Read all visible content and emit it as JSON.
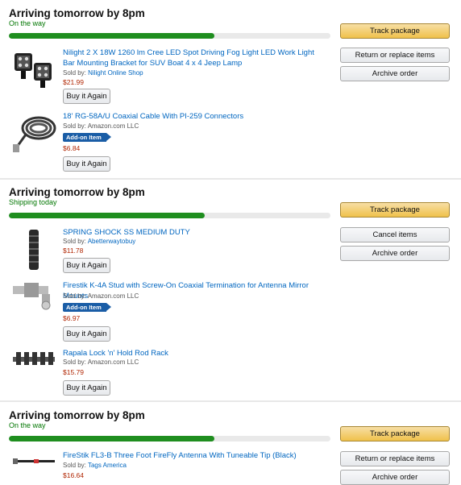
{
  "shipments": [
    {
      "title": "Arriving tomorrow by 8pm",
      "status": "On the way",
      "progress": 0.64,
      "buttons": [
        "Track package",
        "Return or replace items",
        "Archive order"
      ],
      "items": [
        {
          "title": "Nilight 2 X 18W 1260 lm Cree LED Spot Driving Fog Light LED Work Light Bar Mounting Bracket for SUV Boat 4 x 4 Jeep Lamp",
          "sold_by_label": "Sold by:",
          "seller": "Nilight Online Shop",
          "price": "$21.99",
          "buy_again": "Buy it Again",
          "thumb_icon": "led-light-pair-icon"
        },
        {
          "title": "18' RG-58A/U Coaxial Cable With PI-259 Connectors",
          "sold_by_label": "Sold by:",
          "seller": "Amazon.com LLC",
          "addon": "Add-on Item",
          "price": "$6.84",
          "buy_again": "Buy it Again",
          "thumb_icon": "coaxial-cable-icon"
        }
      ]
    },
    {
      "title": "Arriving tomorrow by 8pm",
      "status": "Shipping today",
      "progress": 0.61,
      "buttons": [
        "Track package",
        "Cancel items",
        "Archive order"
      ],
      "items": [
        {
          "title": "SPRING SHOCK SS MEDIUM DUTY",
          "sold_by_label": "Sold by:",
          "seller": "Abetterwaytobuy",
          "price": "$11.78",
          "buy_again": "Buy it Again",
          "thumb_icon": "spring-shock-icon"
        },
        {
          "title": "Firestik K-4A Stud with Screw-On Coaxial Termination for Antenna Mirror Mounts",
          "sold_by_label": "Sold by:",
          "seller": "Amazon.com LLC",
          "addon": "Add-on Item",
          "price": "$6.97",
          "buy_again": "Buy it Again",
          "thumb_icon": "antenna-stud-icon"
        },
        {
          "title": "Rapala Lock 'n' Hold Rod Rack",
          "sold_by_label": "Sold by:",
          "seller": "Amazon.com LLC",
          "price": "$15.79",
          "buy_again": "Buy it Again",
          "thumb_icon": "rod-rack-icon"
        }
      ]
    },
    {
      "title": "Arriving tomorrow by 8pm",
      "status": "On the way",
      "progress": 0.64,
      "buttons": [
        "Track package",
        "Return or replace items",
        "Archive order"
      ],
      "items": [
        {
          "title": "FireStik FL3-B Three Foot FireFly Antenna With Tuneable Tip (Black)",
          "sold_by_label": "Sold by:",
          "seller": "Tags America",
          "price": "$16.64",
          "buy_again": "Buy it Again",
          "thumb_icon": "antenna-rod-icon"
        }
      ]
    }
  ],
  "colors": {
    "status_green": "#007600",
    "progress_fill": "#1f8e1f",
    "link_blue": "#0066c0",
    "price_red": "#b12704",
    "primary_button": "#f0c14b",
    "addon_badge": "#1a5da6"
  }
}
